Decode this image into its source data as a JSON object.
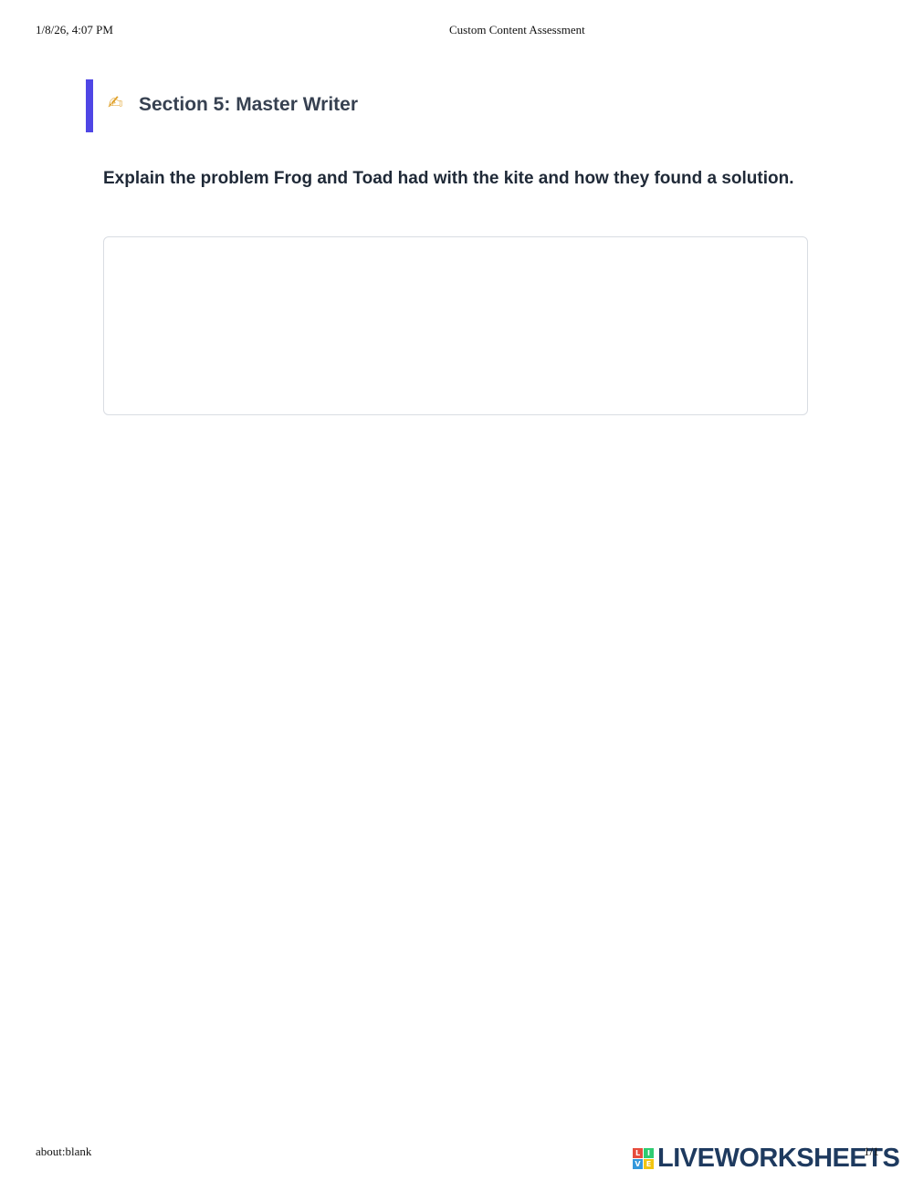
{
  "print_header": {
    "datetime": "1/8/26, 4:07 PM",
    "title": "Custom Content Assessment"
  },
  "section": {
    "icon": "writing-hand-icon",
    "icon_glyph": "✍",
    "title": "Section 5: Master Writer",
    "accent_color": "#4f46e5"
  },
  "question": {
    "text": "Explain the problem Frog and Toad had with the kite and how they found a solution."
  },
  "answer": {
    "value": ""
  },
  "print_footer": {
    "url": "about:blank",
    "page": "1/1"
  },
  "logo": {
    "letters": [
      "L",
      "I",
      "V",
      "E"
    ],
    "colors": [
      "#e74c3c",
      "#2ecc71",
      "#3498db",
      "#f1c40f"
    ],
    "word": "LIVEWORKSHEETS"
  }
}
